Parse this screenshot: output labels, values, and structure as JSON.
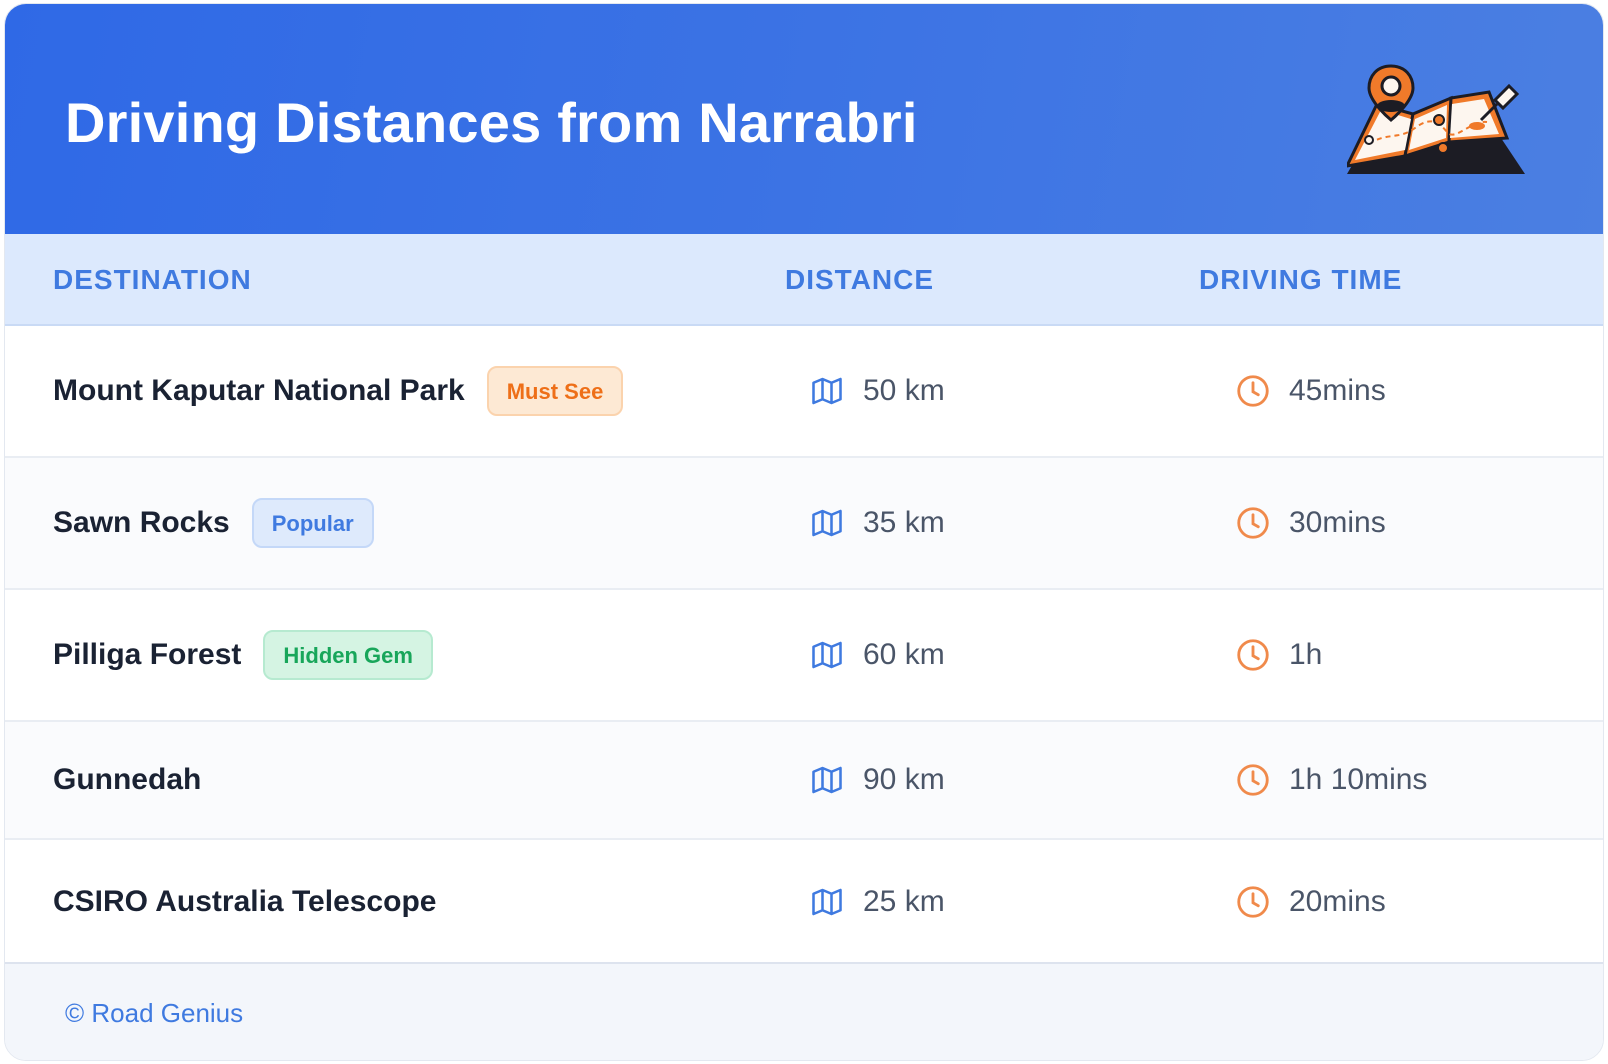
{
  "header": {
    "title": "Driving Distances from Narrabri",
    "illustration": "map-with-location-pin-illustration"
  },
  "columns": {
    "destination": "DESTINATION",
    "distance": "DISTANCE",
    "driving_time": "DRIVING TIME"
  },
  "rows": [
    {
      "destination": "Mount Kaputar National Park",
      "badge": "Must See",
      "badge_style": "orange",
      "distance": "50 km",
      "time": "45mins"
    },
    {
      "destination": "Sawn Rocks",
      "badge": "Popular",
      "badge_style": "blue",
      "distance": "35 km",
      "time": "30mins"
    },
    {
      "destination": "Pilliga Forest",
      "badge": "Hidden Gem",
      "badge_style": "green",
      "distance": "60 km",
      "time": "1h"
    },
    {
      "destination": "Gunnedah",
      "badge": "",
      "badge_style": "",
      "distance": "90 km",
      "time": "1h 10mins"
    },
    {
      "destination": "CSIRO Australia Telescope",
      "badge": "",
      "badge_style": "",
      "distance": "25 km",
      "time": "20mins"
    }
  ],
  "icons": {
    "distance": "map-icon",
    "time": "clock-icon"
  },
  "colors": {
    "header_gradient_start": "#2f69e6",
    "header_gradient_end": "#4b7fe2",
    "column_header_bg": "#dce9fd",
    "column_header_text": "#3f7ae0",
    "map_icon": "#3f7ae0",
    "clock_icon": "#f08a4b",
    "badge_orange_bg": "#fde9d4",
    "badge_orange_text": "#ee6f18",
    "badge_blue_bg": "#deeafc",
    "badge_blue_text": "#3f7ae0",
    "badge_green_bg": "#d5f4e3",
    "badge_green_text": "#18a65a"
  },
  "footer": {
    "credit": "© Road Genius"
  }
}
